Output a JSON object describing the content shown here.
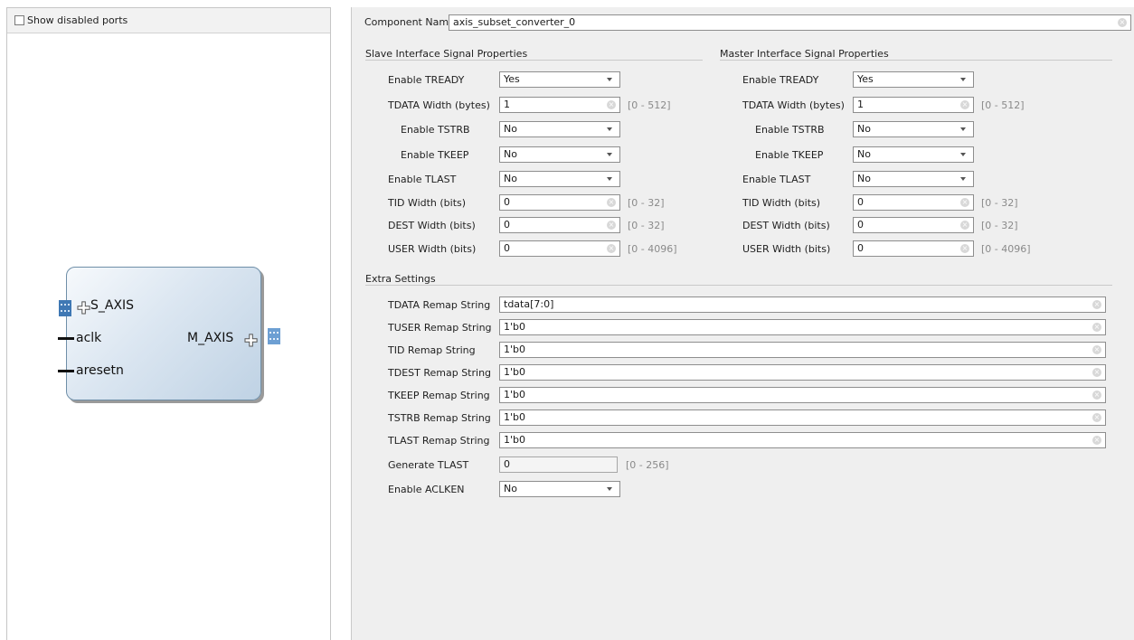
{
  "left": {
    "show_disabled_label": "Show disabled ports",
    "block": {
      "port_s_axis": "S_AXIS",
      "port_aclk": "aclk",
      "port_aresetn": "aresetn",
      "port_m_axis": "M_AXIS"
    }
  },
  "component": {
    "label": "Component Name",
    "value": "axis_subset_converter_0"
  },
  "slave": {
    "title": "Slave Interface Signal Properties",
    "enable_tready": {
      "label": "Enable TREADY",
      "value": "Yes"
    },
    "tdata_width": {
      "label": "TDATA Width (bytes)",
      "value": "1",
      "range": "[0 - 512]"
    },
    "enable_tstrb": {
      "label": "Enable TSTRB",
      "value": "No"
    },
    "enable_tkeep": {
      "label": "Enable TKEEP",
      "value": "No"
    },
    "enable_tlast": {
      "label": "Enable TLAST",
      "value": "No"
    },
    "tid_width": {
      "label": "TID Width (bits)",
      "value": "0",
      "range": "[0 - 32]"
    },
    "dest_width": {
      "label": "DEST Width (bits)",
      "value": "0",
      "range": "[0 - 32]"
    },
    "user_width": {
      "label": "USER Width (bits)",
      "value": "0",
      "range": "[0 - 4096]"
    }
  },
  "master": {
    "title": "Master Interface Signal Properties",
    "enable_tready": {
      "label": "Enable TREADY",
      "value": "Yes"
    },
    "tdata_width": {
      "label": "TDATA Width (bytes)",
      "value": "1",
      "range": "[0 - 512]"
    },
    "enable_tstrb": {
      "label": "Enable TSTRB",
      "value": "No"
    },
    "enable_tkeep": {
      "label": "Enable TKEEP",
      "value": "No"
    },
    "enable_tlast": {
      "label": "Enable TLAST",
      "value": "No"
    },
    "tid_width": {
      "label": "TID Width (bits)",
      "value": "0",
      "range": "[0 - 32]"
    },
    "dest_width": {
      "label": "DEST Width (bits)",
      "value": "0",
      "range": "[0 - 32]"
    },
    "user_width": {
      "label": "USER Width (bits)",
      "value": "0",
      "range": "[0 - 4096]"
    }
  },
  "extra": {
    "title": "Extra Settings",
    "tdata_remap": {
      "label": "TDATA Remap String",
      "value": "tdata[7:0]"
    },
    "tuser_remap": {
      "label": "TUSER Remap String",
      "value": "1'b0"
    },
    "tid_remap": {
      "label": "TID Remap String",
      "value": "1'b0"
    },
    "tdest_remap": {
      "label": "TDEST Remap String",
      "value": "1'b0"
    },
    "tkeep_remap": {
      "label": "TKEEP Remap String",
      "value": "1'b0"
    },
    "tstrb_remap": {
      "label": "TSTRB Remap String",
      "value": "1'b0"
    },
    "tlast_remap": {
      "label": "TLAST Remap String",
      "value": "1'b0"
    },
    "generate_tlast": {
      "label": "Generate TLAST",
      "value": "0",
      "range": "[0 - 256]"
    },
    "enable_aclken": {
      "label": "Enable ACLKEN",
      "value": "No"
    }
  },
  "icons": {
    "clear": "clear-icon",
    "dropdown": "chevron-down-icon",
    "bus": "bus-interface-icon",
    "expand": "plus-icon"
  },
  "colors": {
    "block_border": "#6f8fa8",
    "bus_blue": "#3f78b4",
    "panel_bg": "#efefef"
  }
}
